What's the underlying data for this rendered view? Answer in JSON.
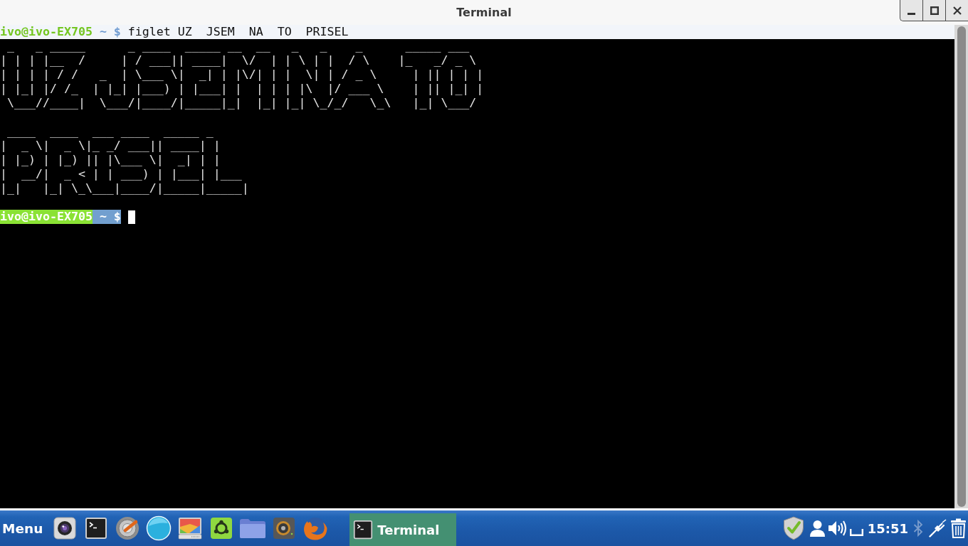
{
  "window": {
    "title": "Terminal"
  },
  "terminal": {
    "command_line": {
      "user_host": "ivo@ivo-EX705",
      "prompt_symbol": "~ $",
      "command": "figlet UZ  JSEM  NA  TO  PRISEL"
    },
    "output_blocks": [
      {
        "lines": [
          " _   _ _____      _ ____  _____ __  __   _   _    _      _____ ___",
          "| | | |__  /     | / ___|| ____|  \\/  | | \\ | |  / \\    |_   _/ _ \\",
          "| | | | / /   _  | \\___ \\|  _| | |\\/| | |  \\| | / _ \\     | || | | |",
          "| |_| |/ /_  | |_| |___) | |___| |  | | | |\\  |/ ___ \\    | || |_| |",
          " \\___//____|  \\___/|____/|_____|_|  |_| |_| \\_/_/   \\_\\   |_| \\___/"
        ]
      },
      {
        "lines": [
          " ____  ____  ___ ____  _____ _",
          "|  _ \\|  _ \\|_ _/ ___|| ____| |",
          "| |_) | |_) || |\\___ \\|  _| | |",
          "|  __/|  _ < | | ___) | |___| |___",
          "|_|   |_| \\_\\___|____/|_____|_____|"
        ]
      }
    ],
    "prompt": {
      "user_host": "ivo@ivo-EX705",
      "prompt_symbol": "~ $"
    }
  },
  "taskbar": {
    "menu_label": "Menu",
    "tasks": [
      {
        "label": "Terminal",
        "selected": true
      }
    ],
    "clock": "15:51",
    "bluetooth": {
      "on": false
    }
  }
}
